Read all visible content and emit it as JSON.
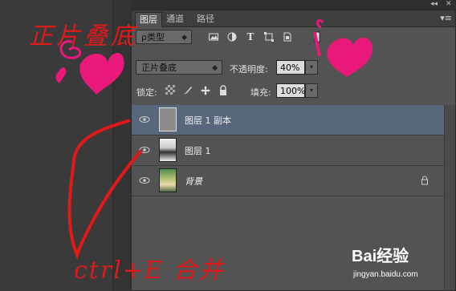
{
  "annotations": {
    "top": "正片叠底",
    "bottom": "ctrl+E 合并"
  },
  "watermark": {
    "brand": "Bai经验",
    "url": "jingyan.baidu.com"
  },
  "topbar": {
    "collapse": "◂◂",
    "close": "✕"
  },
  "tabs": [
    {
      "label": "图层",
      "active": true
    },
    {
      "label": "通道",
      "active": false
    },
    {
      "label": "路径",
      "active": false
    }
  ],
  "panel_menu": "▾≡",
  "filter": {
    "kind_label": "ρ类型",
    "icons": [
      "image-filter-icon",
      "adjustment-filter-icon",
      "type-filter-icon",
      "shape-filter-icon",
      "smart-object-filter-icon"
    ]
  },
  "blend": {
    "mode": "正片叠底",
    "opacity_label": "不透明度:",
    "opacity_value": "40%"
  },
  "lock": {
    "label": "锁定:",
    "fill_label": "填充:",
    "fill_value": "100%"
  },
  "layers": [
    {
      "name": "图层 1 副本",
      "selected": true,
      "visible": true,
      "italic": false,
      "locked": false
    },
    {
      "name": "图层 1",
      "selected": false,
      "visible": true,
      "italic": false,
      "locked": false
    },
    {
      "name": "背景",
      "selected": false,
      "visible": true,
      "italic": true,
      "locked": true
    }
  ],
  "colors": {
    "panel_bg": "#535353",
    "selection": "#59677c",
    "annotation": "#e01a1a",
    "heart": "#e8197a"
  }
}
